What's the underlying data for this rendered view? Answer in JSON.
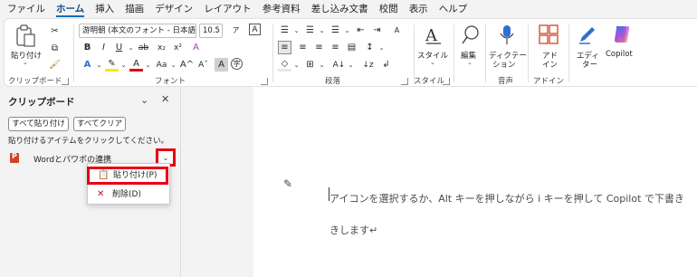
{
  "menu": {
    "tabs": [
      "ファイル",
      "ホーム",
      "挿入",
      "描画",
      "デザイン",
      "レイアウト",
      "参考資料",
      "差し込み文書",
      "校閲",
      "表示",
      "ヘルプ"
    ],
    "active_tab": "ホーム"
  },
  "ribbon": {
    "clipboard": {
      "paste_label": "貼り付け",
      "group_label": "クリップボード"
    },
    "font": {
      "font_name": "游明朝 (本文のフォント - 日本語)",
      "font_size": "10.5",
      "group_label": "フォント"
    },
    "paragraph": {
      "group_label": "段落"
    },
    "styles": {
      "label": "スタイル",
      "group_label": "スタイル"
    },
    "editing": {
      "label": "編集"
    },
    "voice": {
      "dictate_label_1": "ディクテー",
      "dictate_label_2": "ション",
      "group_label": "音声"
    },
    "addins": {
      "label_1": "アド",
      "label_2": "イン",
      "group_label": "アドイン"
    },
    "editor": {
      "label_1": "エディ",
      "label_2": "ター"
    },
    "copilot": {
      "label": "Copilot"
    }
  },
  "clipboard_pane": {
    "title": "クリップボード",
    "paste_all_label": "すべて貼り付け",
    "clear_all_label": "すべてクリア",
    "hint": "貼り付けるアイテムをクリックしてください。",
    "items": [
      {
        "text": "Wordとパワポの連携"
      }
    ],
    "item_menu": {
      "paste_label": "貼り付け(P)",
      "delete_label": "削除(D)"
    }
  },
  "document": {
    "line1": "アイコンを選択するか、Alt キーを押しながら i キーを押して Copilot で下書き",
    "line2": "きします↵"
  },
  "colors": {
    "accent": "#0f6cbd",
    "highlight_box": "#e60012",
    "copilot_gradient": [
      "#2f7de1",
      "#b64de0",
      "#f3a23a"
    ]
  }
}
